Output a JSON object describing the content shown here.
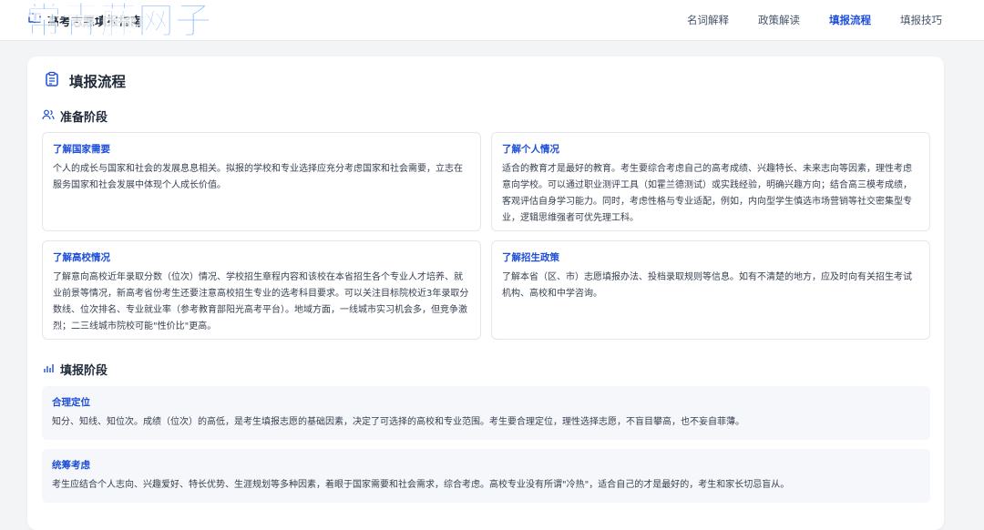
{
  "header": {
    "brand_title": "高考志愿填报指南",
    "watermark": "常青藤网子",
    "nav": [
      {
        "label": "名词解释"
      },
      {
        "label": "政策解读"
      },
      {
        "label": "填报流程"
      },
      {
        "label": "填报技巧"
      }
    ],
    "active_nav": "填报流程"
  },
  "main": {
    "title": "填报流程",
    "prep": {
      "heading": "准备阶段",
      "cards": [
        {
          "title": "了解国家需要",
          "text": "个人的成长与国家和社会的发展息息相关。拟报的学校和专业选择应充分考虑国家和社会需要，立志在服务国家和社会发展中体现个人成长价值。"
        },
        {
          "title": "了解个人情况",
          "text": "适合的教育才是最好的教育。考生要综合考虑自己的高考成绩、兴趣特长、未来志向等因素，理性考虑意向学校。可以通过职业测评工具（如霍兰德测试）或实践经验，明确兴趣方向；结合高三模考成绩，客观评估自身学习能力。同时，考虑性格与专业适配，例如，内向型学生慎选市场营销等社交密集型专业，逻辑思维强者可优先理工科。"
        },
        {
          "title": "了解高校情况",
          "text": "了解意向高校近年录取分数（位次）情况、学校招生章程内容和该校在本省招生各个专业人才培养、就业前景等情况，新高考省份考生还要注意高校招生专业的选考科目要求。可以关注目标院校近3年录取分数线、位次排名、专业就业率（参考教育部阳光高考平台）。地域方面，一线城市实习机会多，但竞争激烈；二三线城市院校可能\"性价比\"更高。"
        },
        {
          "title": "了解招生政策",
          "text": "了解本省（区、市）志愿填报办法、投档录取规则等信息。如有不清楚的地方，应及时向有关招生考试机构、高校和中学咨询。"
        }
      ]
    },
    "fill": {
      "heading": "填报阶段",
      "steps": [
        {
          "title": "合理定位",
          "text": "知分、知线、知位次。成绩（位次）的高低，是考生填报志愿的基础因素，决定了可选择的高校和专业范围。考生要合理定位，理性选择志愿，不盲目攀高，也不妄自菲薄。"
        },
        {
          "title": "统筹考虑",
          "text": "考生应结合个人志向、兴趣爱好、特长优势、生涯规划等多种因素，着眼于国家需要和社会需求，综合考虑。高校专业没有所谓\"冷热\"，适合自己的才是最好的，考生和家长切忌盲从。"
        }
      ]
    }
  },
  "colors": {
    "accent": "#1d4ed8",
    "watermark": "#6ea8ff"
  },
  "icons": [
    "book-icon",
    "clipboard-icon",
    "users-icon",
    "bar-chart-icon"
  ]
}
